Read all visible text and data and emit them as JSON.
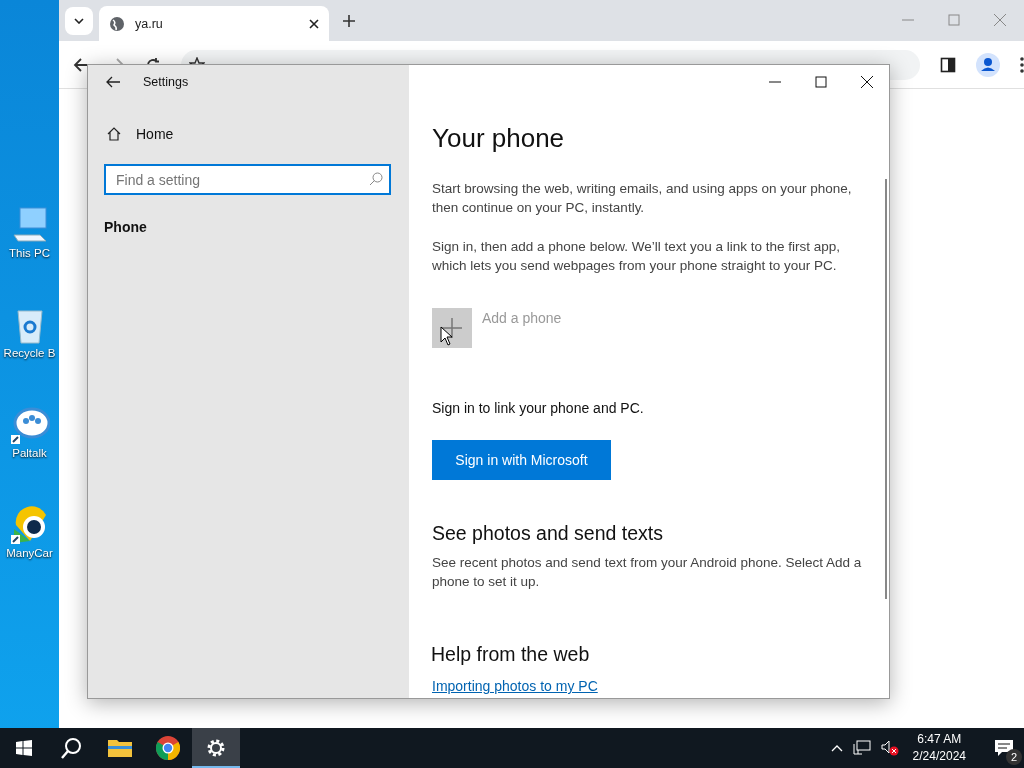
{
  "desktop_icons": [
    {
      "kind": "computer",
      "label": "This PC"
    },
    {
      "kind": "bin",
      "label": "Recycle B"
    },
    {
      "kind": "chat",
      "label": "Paltalk"
    },
    {
      "kind": "cam",
      "label": "ManyCar"
    }
  ],
  "browser": {
    "tab_title": "ya.ru"
  },
  "settings": {
    "title": "Settings",
    "home": "Home",
    "search": {
      "placeholder": "Find a setting"
    },
    "current_page": "Phone",
    "heading": "Your phone",
    "intro": "Start browsing the web, writing emails, and using apps on your phone, then continue on your PC, instantly.",
    "instructions": "Sign in, then add a phone below. We’ll text you a link to the first app, which lets you send webpages from your phone straight to your PC.",
    "add_phone": {
      "label": "Add a phone",
      "disabled": true
    },
    "sign_in_prompt": "Sign in to link your phone and PC.",
    "sign_in_button": "Sign in with Microsoft",
    "photos_heading": "See photos and send texts",
    "photos_text": "See recent photos and send text from your Android phone. Select Add a phone to set it up.",
    "help_heading": "Help from the web",
    "help_link": "Importing photos to my PC"
  },
  "taskbar": {
    "apps": [
      {
        "kind": "search",
        "selected": false
      },
      {
        "kind": "folder",
        "selected": false
      },
      {
        "kind": "chrome",
        "selected": false
      },
      {
        "kind": "gear",
        "selected": true
      }
    ],
    "time": "6:47 AM",
    "date": "2/24/2024",
    "notifications": "2"
  }
}
